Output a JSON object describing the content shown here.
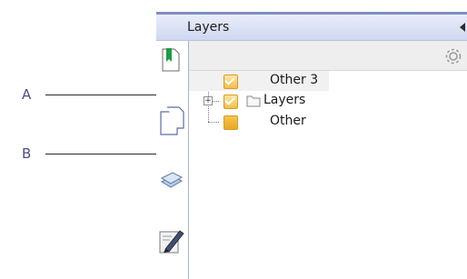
{
  "callouts": {
    "a": "A",
    "b": "B"
  },
  "panel": {
    "title": "Layers",
    "collapse_icon": "triangle-left-icon",
    "options_icon": "gear-icon"
  },
  "nav": [
    {
      "name": "bookmarks",
      "icon": "bookmark-page-icon"
    },
    {
      "name": "pages",
      "icon": "pages-icon"
    },
    {
      "name": "layers",
      "icon": "layers-icon"
    },
    {
      "name": "signatures",
      "icon": "pen-signature-icon"
    }
  ],
  "tree": {
    "items": [
      {
        "label": "Other 3",
        "checked": true,
        "expander": false,
        "folder": false
      },
      {
        "label": "Layers",
        "checked": true,
        "expander": true,
        "expander_symbol": "+",
        "folder": true
      },
      {
        "label": "Other",
        "checked": false,
        "expander": false,
        "folder": false
      }
    ]
  },
  "colors": {
    "header_border": "#7f8ec6",
    "checkbox_orange": "#f3bd4d",
    "callout_text": "#4a4e86"
  }
}
